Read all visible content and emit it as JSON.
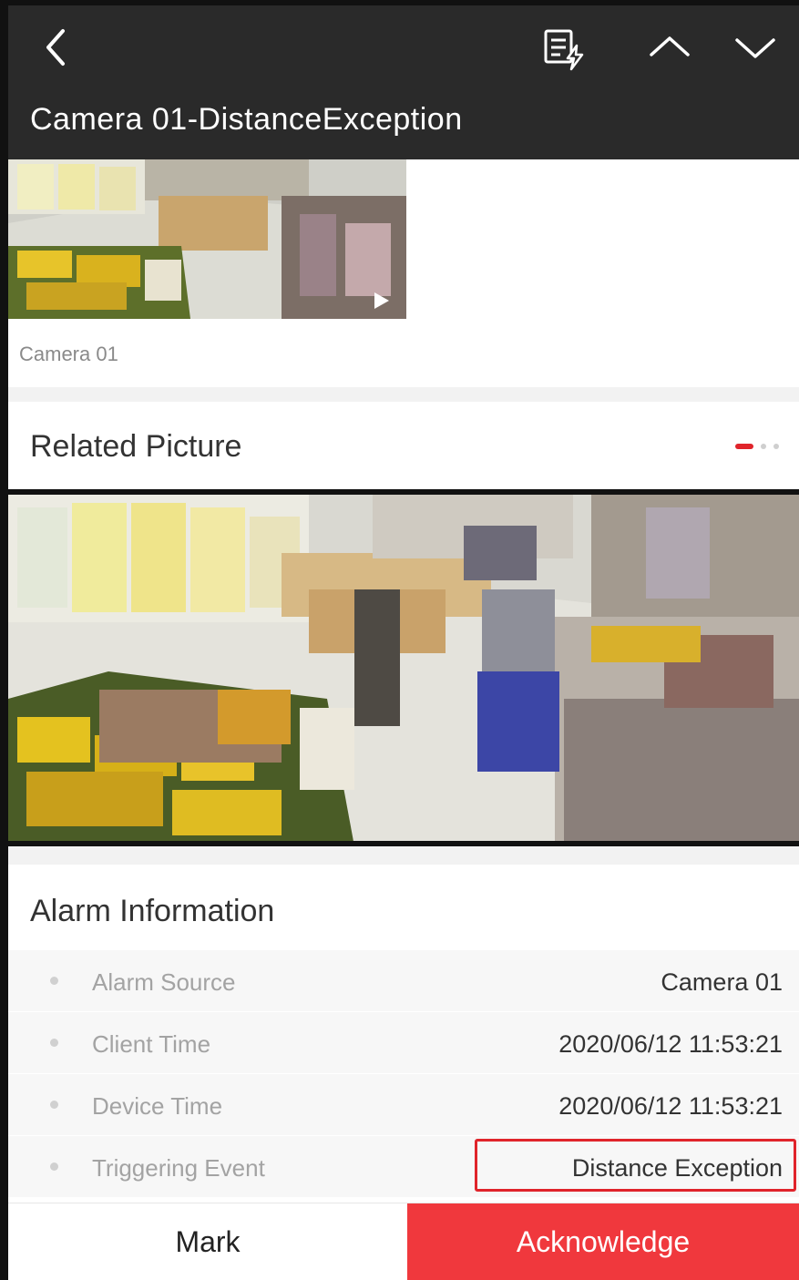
{
  "header": {
    "title": "Camera 01-DistanceException",
    "icons": [
      "back-icon",
      "event-linkage-icon",
      "chevron-up-icon",
      "chevron-down-icon"
    ]
  },
  "video": {
    "camera_label": "Camera 01",
    "icon": "play-icon"
  },
  "related": {
    "title": "Related Picture",
    "page_count": 3,
    "active_page": 1
  },
  "alarm": {
    "title": "Alarm Information",
    "rows": [
      {
        "label": "Alarm Source",
        "value": "Camera 01"
      },
      {
        "label": "Client Time",
        "value": "2020/06/12 11:53:21"
      },
      {
        "label": "Device Time",
        "value": "2020/06/12 11:53:21"
      },
      {
        "label": "Triggering Event",
        "value": "Distance Exception"
      }
    ],
    "highlight_color": "#e0242b"
  },
  "footer": {
    "mark_label": "Mark",
    "acknowledge_label": "Acknowledge",
    "accent_color": "#f0383d"
  }
}
